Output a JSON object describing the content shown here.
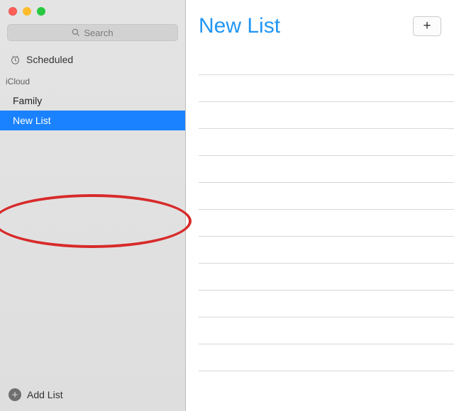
{
  "search": {
    "placeholder": "Search"
  },
  "scheduled": {
    "label": "Scheduled"
  },
  "icloud": {
    "label": "iCloud"
  },
  "lists": {
    "items": [
      {
        "label": "Family"
      },
      {
        "label": "New List"
      }
    ]
  },
  "addList": {
    "label": "Add List"
  },
  "main": {
    "title": "New List"
  },
  "colors": {
    "accent": "#2196f3",
    "selection": "#1a82ff",
    "annotation": "#d82a2a"
  }
}
